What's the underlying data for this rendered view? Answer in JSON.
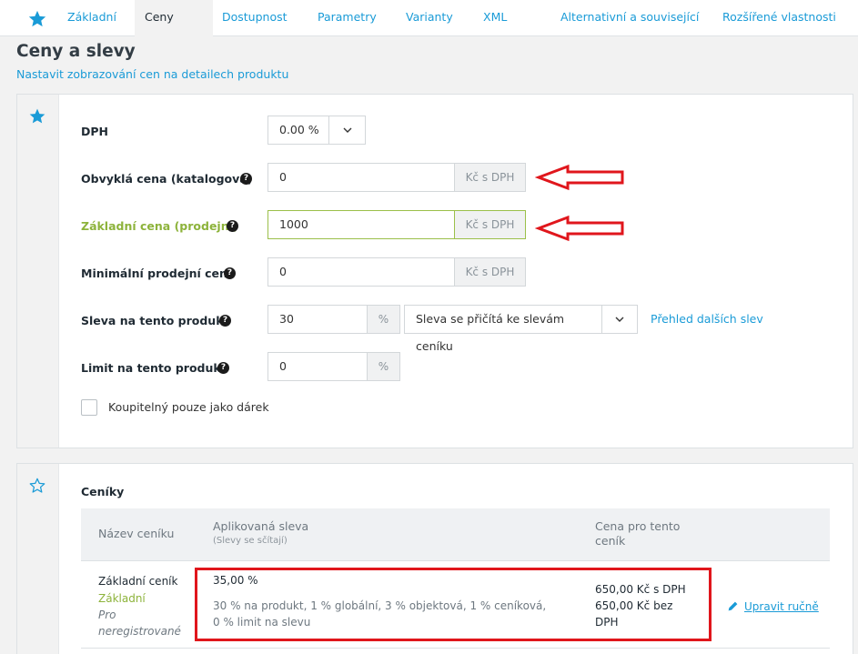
{
  "tabs": [
    {
      "label": "Základní",
      "active": false
    },
    {
      "label": "Ceny",
      "active": true
    },
    {
      "label": "Dostupnost",
      "active": false
    },
    {
      "label": "Parametry",
      "active": false
    },
    {
      "label": "Varianty",
      "active": false
    },
    {
      "label": "XML",
      "active": false
    },
    {
      "label": "Alternativní a související",
      "active": false
    },
    {
      "label": "Rozšířené vlastnosti",
      "active": false
    }
  ],
  "page": {
    "title": "Ceny a slevy",
    "subtitle_link": "Nastavit zobrazování cen na detailech produktu"
  },
  "pricing": {
    "vat": {
      "label": "DPH",
      "value": "0.00 %"
    },
    "regular_price": {
      "label": "Obvyklá cena (katalogová)",
      "value": "0",
      "unit": "Kč s DPH"
    },
    "base_price": {
      "label": "Základní cena (prodejní)",
      "value": "1000",
      "unit": "Kč s DPH"
    },
    "min_price": {
      "label": "Minimální prodejní cena",
      "value": "0",
      "unit": "Kč s DPH"
    },
    "discount": {
      "label": "Sleva na tento produkt",
      "value": "30",
      "unit": "%",
      "mode": "Sleva se přičítá ke slevám ceníku",
      "link": "Přehled dalších slev"
    },
    "limit": {
      "label": "Limit na tento produkt",
      "value": "0",
      "unit": "%"
    },
    "gift_only": {
      "label": "Koupitelný pouze jako dárek",
      "checked": false
    }
  },
  "pricelists": {
    "title": "Ceníky",
    "headers": {
      "name": "Název ceníku",
      "discount": "Aplikovaná sleva",
      "discount_note": "(Slevy se sčítají)",
      "price_line1": "Cena pro tento",
      "price_line2": "ceník"
    },
    "rows": [
      {
        "name": "Základní ceník",
        "group": "Základní",
        "audience_line1": "Pro",
        "audience_line2": "neregistrované",
        "discount_total": "35,00 %",
        "discount_detail_line1": "30 % na produkt, 1 % globální, 3 % objektová, 1 % ceníková,",
        "discount_detail_line2": "0 % limit na slevu",
        "price_vat": "650,00 Kč s DPH",
        "price_novat_line1": "650,00 Kč bez",
        "price_novat_line2": "DPH",
        "edit_link": "Upravit ručně"
      }
    ]
  },
  "colors": {
    "accent": "#1a9bd7",
    "green": "#8db33b",
    "annotation_red": "#e0161c"
  }
}
